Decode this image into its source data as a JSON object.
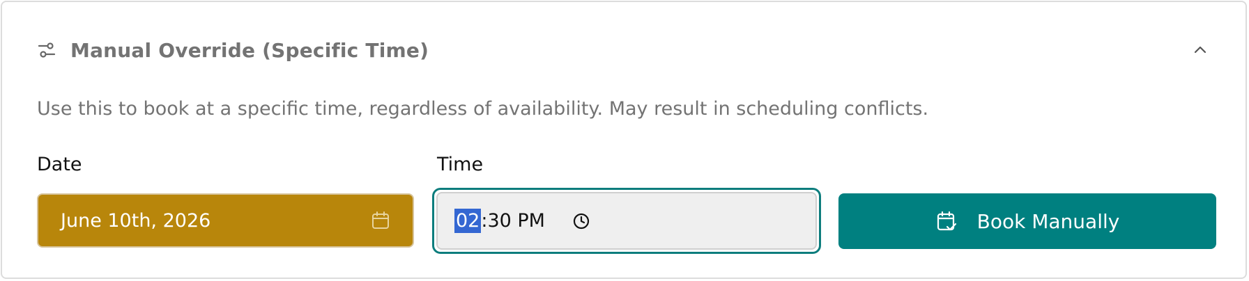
{
  "override": {
    "title": "Manual Override (Specific Time)",
    "description": "Use this to book at a specific time, regardless of availability. May result in scheduling conflicts.",
    "icons": {
      "header": "sliders-icon",
      "collapse": "chevron-up-icon",
      "date": "calendar-icon",
      "time": "clock-icon",
      "book": "calendar-check-icon"
    }
  },
  "date": {
    "label": "Date",
    "value": "June 10th, 2026"
  },
  "time": {
    "label": "Time",
    "hour": "02",
    "rest": ":30 PM"
  },
  "book_button": {
    "label": "Book Manually"
  },
  "colors": {
    "date_field": "#b8860b",
    "button": "#008080",
    "focus_ring": "#0d7d7d",
    "selected_segment": "#3467d2",
    "muted_text": "#737373"
  }
}
